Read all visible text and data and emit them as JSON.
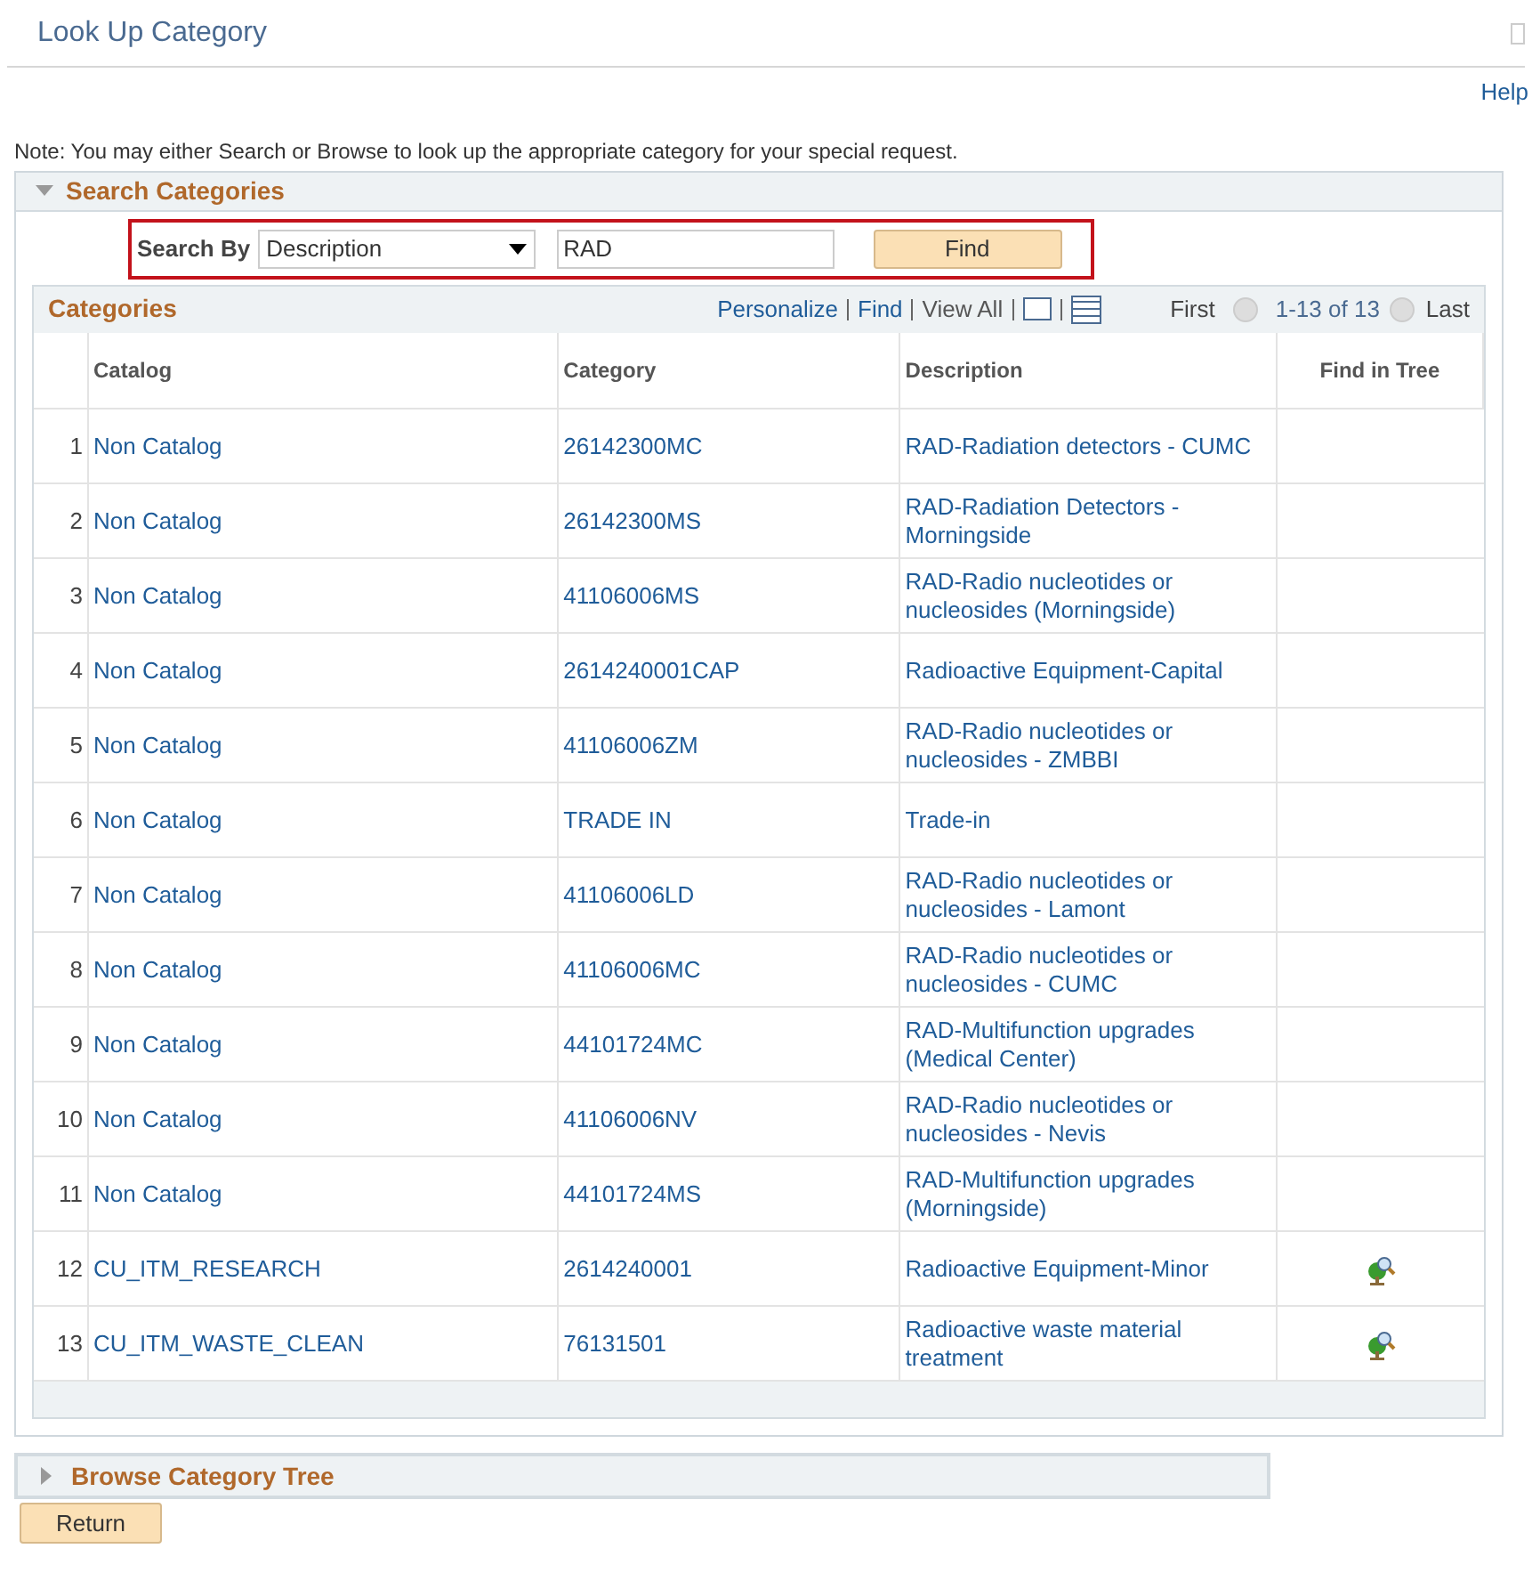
{
  "window": {
    "title": "Look Up Category",
    "help": "Help"
  },
  "note": "Note: You may either Search or Browse to look up the appropriate category for your special request.",
  "search_section": {
    "title": "Search Categories",
    "expanded": true,
    "search_by_label": "Search By",
    "search_by_value": "Description",
    "search_value": "RAD",
    "find_button": "Find"
  },
  "grid": {
    "title": "Categories",
    "links": [
      "Personalize",
      "Find"
    ],
    "view_all": "View All",
    "first": "First",
    "range": "1-13 of 13",
    "last": "Last",
    "columns": [
      "Catalog",
      "Category",
      "Description",
      "Find in Tree"
    ],
    "rows": [
      {
        "num": "1",
        "catalog": "Non Catalog",
        "category": "26142300MC",
        "description": "RAD-Radiation detectors - CUMC",
        "find_in_tree": false
      },
      {
        "num": "2",
        "catalog": "Non Catalog",
        "category": "26142300MS",
        "description": "RAD-Radiation Detectors - Morningside",
        "find_in_tree": false
      },
      {
        "num": "3",
        "catalog": "Non Catalog",
        "category": "41106006MS",
        "description": "RAD-Radio nucleotides or nucleosides  (Morningside)",
        "find_in_tree": false
      },
      {
        "num": "4",
        "catalog": "Non Catalog",
        "category": "2614240001CAP",
        "description": "Radioactive Equipment-Capital",
        "find_in_tree": false
      },
      {
        "num": "5",
        "catalog": "Non Catalog",
        "category": "41106006ZM",
        "description": "RAD-Radio nucleotides or nucleosides - ZMBBI",
        "find_in_tree": false
      },
      {
        "num": "6",
        "catalog": "Non Catalog",
        "category": "TRADE IN",
        "description": "Trade-in",
        "find_in_tree": false
      },
      {
        "num": "7",
        "catalog": "Non Catalog",
        "category": "41106006LD",
        "description": "RAD-Radio nucleotides or nucleosides - Lamont",
        "find_in_tree": false
      },
      {
        "num": "8",
        "catalog": "Non Catalog",
        "category": "41106006MC",
        "description": "RAD-Radio nucleotides or nucleosides - CUMC",
        "find_in_tree": false
      },
      {
        "num": "9",
        "catalog": "Non Catalog",
        "category": "44101724MC",
        "description": "RAD-Multifunction upgrades (Medical Center)",
        "find_in_tree": false
      },
      {
        "num": "10",
        "catalog": "Non Catalog",
        "category": "41106006NV",
        "description": "RAD-Radio nucleotides or nucleosides - Nevis",
        "find_in_tree": false
      },
      {
        "num": "11",
        "catalog": "Non Catalog",
        "category": "44101724MS",
        "description": "RAD-Multifunction upgrades (Morningside)",
        "find_in_tree": false
      },
      {
        "num": "12",
        "catalog": "CU_ITM_RESEARCH",
        "category": "2614240001",
        "description": "Radioactive Equipment-Minor",
        "find_in_tree": true
      },
      {
        "num": "13",
        "catalog": "CU_ITM_WASTE_CLEAN",
        "category": "76131501",
        "description": "Radioactive waste material treatment",
        "find_in_tree": true
      }
    ]
  },
  "browse_section": {
    "title": "Browse Category Tree",
    "expanded": false
  },
  "return_button": "Return"
}
